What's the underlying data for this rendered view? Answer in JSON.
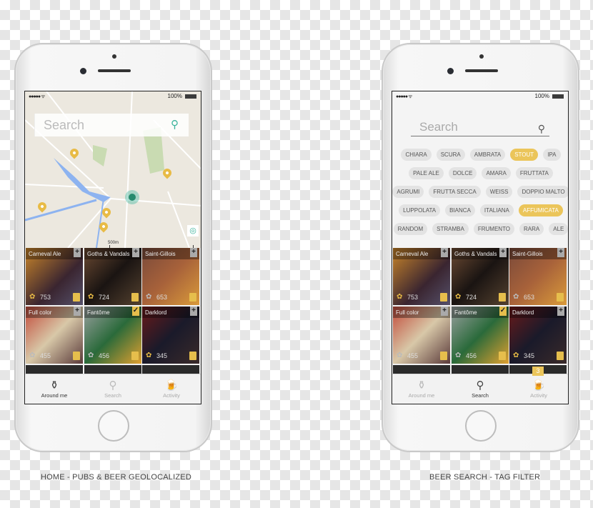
{
  "colors": {
    "accent": "#ebc55a",
    "map_accent": "#3ab39b"
  },
  "status": {
    "signal": "●●●●● ᯤ",
    "battery": "100%"
  },
  "beers": [
    {
      "name": "Carneval Ale",
      "score": "753",
      "medal": "gold",
      "bookmark": "+",
      "bg": "linear-gradient(135deg,#c9852a,#3a2530 60%,#55506a)"
    },
    {
      "name": "Goths & Vandals",
      "score": "724",
      "medal": "gold",
      "bookmark": "+",
      "bg": "linear-gradient(135deg,#6b4a32,#1a1412 50%,#54412f)"
    },
    {
      "name": "Saint-Gillois",
      "score": "653",
      "medal": "silver",
      "bookmark": "+",
      "bg": "linear-gradient(135deg,#7a4a3a,#a8623a 50%,#d99a3a)"
    },
    {
      "name": "Full color",
      "score": "455",
      "medal": "silver",
      "bookmark": "+",
      "bg": "linear-gradient(135deg,#c24a3a,#d8c8a8 50%,#5a3a3a)"
    },
    {
      "name": "Fantôme",
      "score": "456",
      "medal": "silver",
      "bookmark": "✓",
      "bg": "linear-gradient(135deg,#9aa0a0,#2a6a3a 50%,#e0a030)"
    },
    {
      "name": "Darklord",
      "score": "345",
      "medal": "gold",
      "bookmark": "+",
      "bg": "linear-gradient(135deg,#6a1a1a,#1a1a2a 50%,#3a2a2a)"
    }
  ],
  "tabs": [
    {
      "label": "Around me",
      "icon": "bottles-icon"
    },
    {
      "label": "Search",
      "icon": "search-icon"
    },
    {
      "label": "Activity",
      "icon": "beer-mugs-icon"
    }
  ],
  "home": {
    "search_placeholder": "Search",
    "scale_label": "500m",
    "active_tab": 0,
    "caption": "HOME - PUBS & BEER GEOLOCALIZED"
  },
  "search_screen": {
    "search_placeholder": "Search",
    "tag_rows": [
      [
        {
          "label": "CHIARA"
        },
        {
          "label": "SCURA"
        },
        {
          "label": "AMBRATA"
        },
        {
          "label": "STOUT",
          "selected": true
        },
        {
          "label": "IPA"
        }
      ],
      [
        {
          "label": "PALE ALE"
        },
        {
          "label": "DOLCE"
        },
        {
          "label": "AMARA"
        },
        {
          "label": "FRUTTATA"
        }
      ],
      [
        {
          "label": "AGRUMI"
        },
        {
          "label": "FRUTTA SECCA"
        },
        {
          "label": "WEISS"
        },
        {
          "label": "DOPPIO MALTO"
        }
      ],
      [
        {
          "label": "LUPPOLATA"
        },
        {
          "label": "BIANCA"
        },
        {
          "label": "ITALIANA"
        },
        {
          "label": "AFFUMICATA",
          "selected": true
        }
      ],
      [
        {
          "label": "RANDOM"
        },
        {
          "label": "STRAMBA"
        },
        {
          "label": "FRUMENTO"
        },
        {
          "label": "RARA"
        },
        {
          "label": "ALE"
        }
      ]
    ],
    "active_tab": 1,
    "activity_badge": "3",
    "caption": "BEER SEARCH - TAG FILTER"
  }
}
